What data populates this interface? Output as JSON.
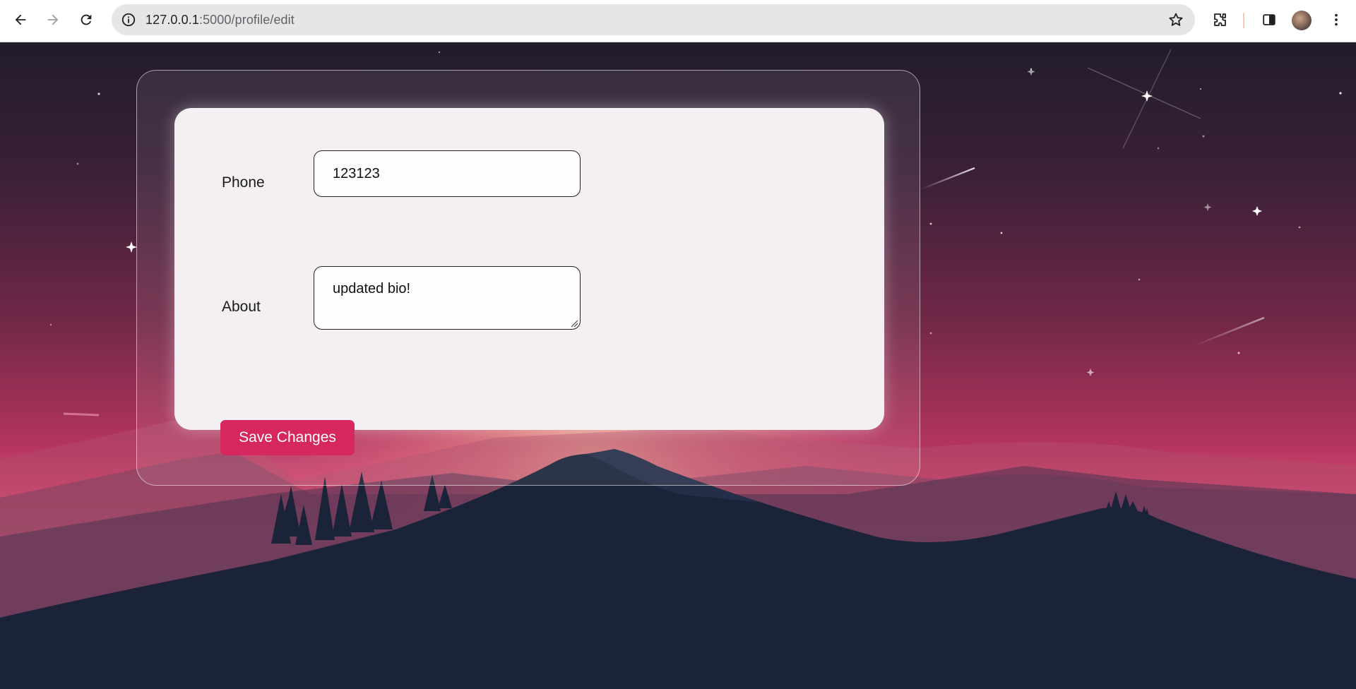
{
  "browser": {
    "url_host": "127.0.0.1",
    "url_path": ":5000/profile/edit"
  },
  "form": {
    "phone_label": "Phone",
    "phone_value": "123123",
    "about_label": "About",
    "about_value": "updated bio!",
    "save_label": "Save Changes"
  },
  "colors": {
    "accent": "#d6285e",
    "card_bg": "#f3eff3"
  }
}
